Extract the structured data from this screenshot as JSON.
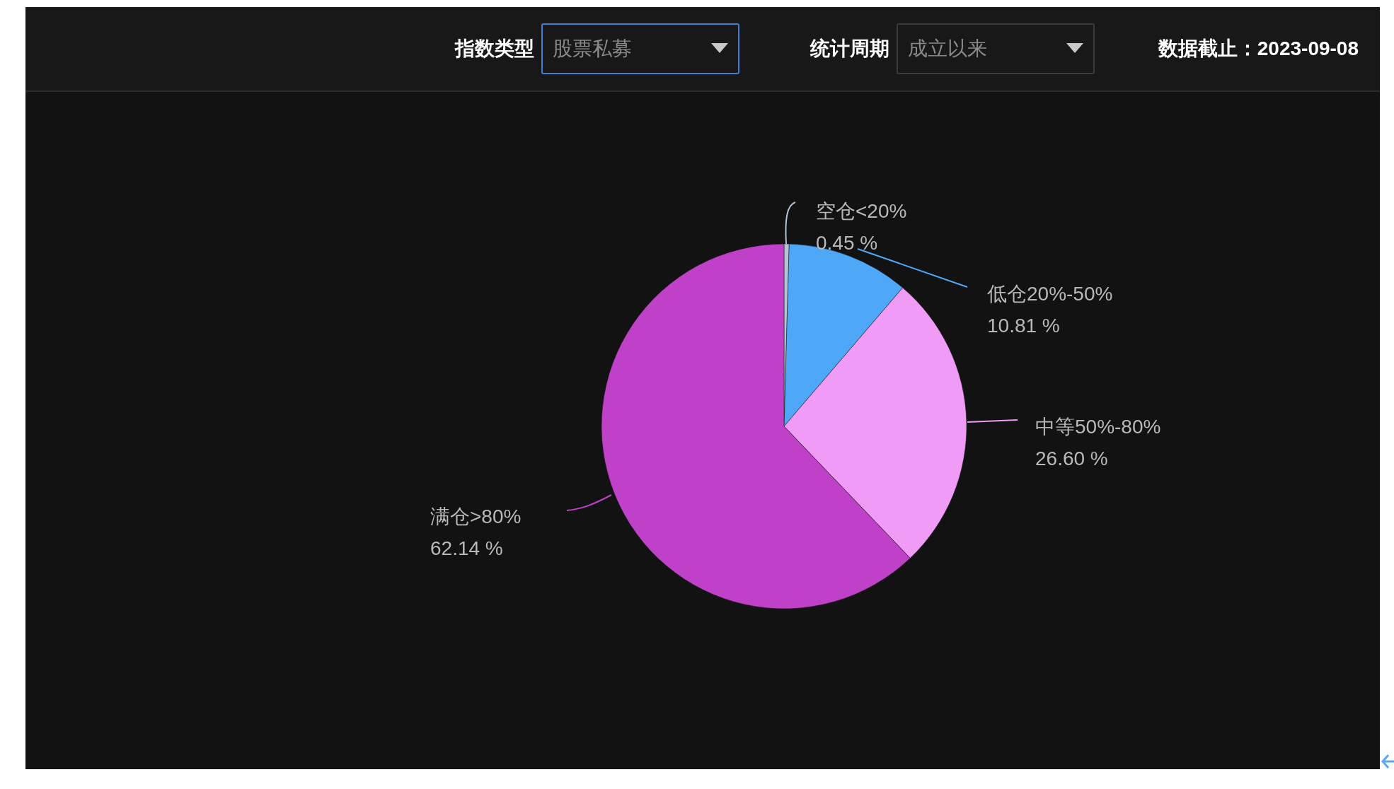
{
  "toolbar": {
    "filters": [
      {
        "label": "指数类型",
        "value": "股票私募",
        "focused": true
      },
      {
        "label": "统计周期",
        "value": "成立以来",
        "focused": false
      }
    ],
    "as_of": "数据截止：2023-09-08"
  },
  "chart": {
    "slices": [
      {
        "color": "#b8c4d6"
      },
      {
        "color": "#4ea8f7"
      },
      {
        "color": "#f09cf7"
      },
      {
        "color": "#be41c7"
      }
    ],
    "chart_data": {
      "type": "pie",
      "categories": [
        "空仓<20%",
        "低仓20%-50%",
        "中等50%-80%",
        "满仓>80%"
      ],
      "values": [
        0.45,
        10.81,
        26.6,
        62.14
      ],
      "value_labels": [
        "0.45 %",
        "10.81 %",
        "26.60 %",
        "62.14 %"
      ]
    }
  }
}
